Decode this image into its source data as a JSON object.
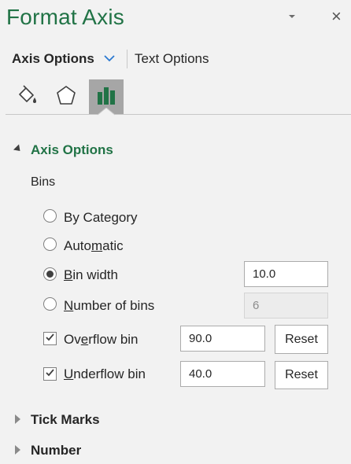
{
  "pane": {
    "title": "Format Axis",
    "close_glyph": "×",
    "icons": {
      "collapse": "chevron-down-icon",
      "close": "close-icon"
    }
  },
  "tabs": {
    "axis_options": "Axis Options",
    "text_options": "Text Options"
  },
  "category_icons": [
    "paint-bucket-icon",
    "pentagon-icon",
    "bar-chart-icon"
  ],
  "colors": {
    "accent": "#217346",
    "selected_icon_bg": "#a6a6a6"
  },
  "sections": {
    "axis_options": {
      "label": "Axis Options",
      "expanded": true,
      "bins_label": "Bins",
      "by_category": {
        "pre": "By Category",
        "u": "",
        "post": "",
        "checked": false
      },
      "automatic": {
        "pre": "Auto",
        "u": "m",
        "post": "atic",
        "checked": false
      },
      "bin_width": {
        "pre": "",
        "u": "B",
        "post": "in width",
        "checked": true,
        "value": "10.0"
      },
      "number_of_bins": {
        "pre": "",
        "u": "N",
        "post": "umber of bins",
        "checked": false,
        "value": "6",
        "disabled": true
      },
      "overflow_bin": {
        "pre": "Ov",
        "u": "e",
        "post": "rflow bin",
        "checked": true,
        "value": "90.0",
        "reset": "Reset"
      },
      "underflow_bin": {
        "pre": "",
        "u": "U",
        "post": "nderflow bin",
        "checked": true,
        "value": "40.0",
        "reset": "Reset"
      }
    },
    "tick_marks": {
      "label": "Tick Marks",
      "expanded": false
    },
    "number": {
      "label": "Number",
      "expanded": false
    }
  }
}
